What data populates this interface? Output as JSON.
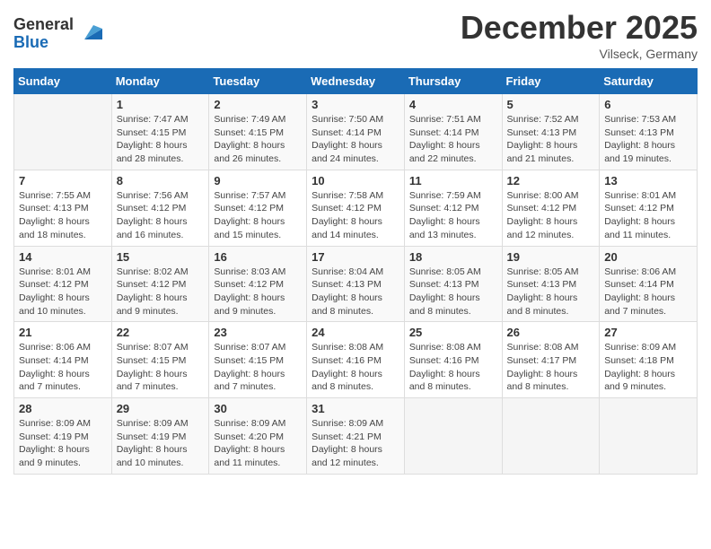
{
  "logo": {
    "general": "General",
    "blue": "Blue"
  },
  "header": {
    "month": "December 2025",
    "location": "Vilseck, Germany"
  },
  "weekdays": [
    "Sunday",
    "Monday",
    "Tuesday",
    "Wednesday",
    "Thursday",
    "Friday",
    "Saturday"
  ],
  "weeks": [
    [
      {
        "day": "",
        "sunrise": "",
        "sunset": "",
        "daylight": ""
      },
      {
        "day": "1",
        "sunrise": "Sunrise: 7:47 AM",
        "sunset": "Sunset: 4:15 PM",
        "daylight": "Daylight: 8 hours and 28 minutes."
      },
      {
        "day": "2",
        "sunrise": "Sunrise: 7:49 AM",
        "sunset": "Sunset: 4:15 PM",
        "daylight": "Daylight: 8 hours and 26 minutes."
      },
      {
        "day": "3",
        "sunrise": "Sunrise: 7:50 AM",
        "sunset": "Sunset: 4:14 PM",
        "daylight": "Daylight: 8 hours and 24 minutes."
      },
      {
        "day": "4",
        "sunrise": "Sunrise: 7:51 AM",
        "sunset": "Sunset: 4:14 PM",
        "daylight": "Daylight: 8 hours and 22 minutes."
      },
      {
        "day": "5",
        "sunrise": "Sunrise: 7:52 AM",
        "sunset": "Sunset: 4:13 PM",
        "daylight": "Daylight: 8 hours and 21 minutes."
      },
      {
        "day": "6",
        "sunrise": "Sunrise: 7:53 AM",
        "sunset": "Sunset: 4:13 PM",
        "daylight": "Daylight: 8 hours and 19 minutes."
      }
    ],
    [
      {
        "day": "7",
        "sunrise": "Sunrise: 7:55 AM",
        "sunset": "Sunset: 4:13 PM",
        "daylight": "Daylight: 8 hours and 18 minutes."
      },
      {
        "day": "8",
        "sunrise": "Sunrise: 7:56 AM",
        "sunset": "Sunset: 4:12 PM",
        "daylight": "Daylight: 8 hours and 16 minutes."
      },
      {
        "day": "9",
        "sunrise": "Sunrise: 7:57 AM",
        "sunset": "Sunset: 4:12 PM",
        "daylight": "Daylight: 8 hours and 15 minutes."
      },
      {
        "day": "10",
        "sunrise": "Sunrise: 7:58 AM",
        "sunset": "Sunset: 4:12 PM",
        "daylight": "Daylight: 8 hours and 14 minutes."
      },
      {
        "day": "11",
        "sunrise": "Sunrise: 7:59 AM",
        "sunset": "Sunset: 4:12 PM",
        "daylight": "Daylight: 8 hours and 13 minutes."
      },
      {
        "day": "12",
        "sunrise": "Sunrise: 8:00 AM",
        "sunset": "Sunset: 4:12 PM",
        "daylight": "Daylight: 8 hours and 12 minutes."
      },
      {
        "day": "13",
        "sunrise": "Sunrise: 8:01 AM",
        "sunset": "Sunset: 4:12 PM",
        "daylight": "Daylight: 8 hours and 11 minutes."
      }
    ],
    [
      {
        "day": "14",
        "sunrise": "Sunrise: 8:01 AM",
        "sunset": "Sunset: 4:12 PM",
        "daylight": "Daylight: 8 hours and 10 minutes."
      },
      {
        "day": "15",
        "sunrise": "Sunrise: 8:02 AM",
        "sunset": "Sunset: 4:12 PM",
        "daylight": "Daylight: 8 hours and 9 minutes."
      },
      {
        "day": "16",
        "sunrise": "Sunrise: 8:03 AM",
        "sunset": "Sunset: 4:12 PM",
        "daylight": "Daylight: 8 hours and 9 minutes."
      },
      {
        "day": "17",
        "sunrise": "Sunrise: 8:04 AM",
        "sunset": "Sunset: 4:13 PM",
        "daylight": "Daylight: 8 hours and 8 minutes."
      },
      {
        "day": "18",
        "sunrise": "Sunrise: 8:05 AM",
        "sunset": "Sunset: 4:13 PM",
        "daylight": "Daylight: 8 hours and 8 minutes."
      },
      {
        "day": "19",
        "sunrise": "Sunrise: 8:05 AM",
        "sunset": "Sunset: 4:13 PM",
        "daylight": "Daylight: 8 hours and 8 minutes."
      },
      {
        "day": "20",
        "sunrise": "Sunrise: 8:06 AM",
        "sunset": "Sunset: 4:14 PM",
        "daylight": "Daylight: 8 hours and 7 minutes."
      }
    ],
    [
      {
        "day": "21",
        "sunrise": "Sunrise: 8:06 AM",
        "sunset": "Sunset: 4:14 PM",
        "daylight": "Daylight: 8 hours and 7 minutes."
      },
      {
        "day": "22",
        "sunrise": "Sunrise: 8:07 AM",
        "sunset": "Sunset: 4:15 PM",
        "daylight": "Daylight: 8 hours and 7 minutes."
      },
      {
        "day": "23",
        "sunrise": "Sunrise: 8:07 AM",
        "sunset": "Sunset: 4:15 PM",
        "daylight": "Daylight: 8 hours and 7 minutes."
      },
      {
        "day": "24",
        "sunrise": "Sunrise: 8:08 AM",
        "sunset": "Sunset: 4:16 PM",
        "daylight": "Daylight: 8 hours and 8 minutes."
      },
      {
        "day": "25",
        "sunrise": "Sunrise: 8:08 AM",
        "sunset": "Sunset: 4:16 PM",
        "daylight": "Daylight: 8 hours and 8 minutes."
      },
      {
        "day": "26",
        "sunrise": "Sunrise: 8:08 AM",
        "sunset": "Sunset: 4:17 PM",
        "daylight": "Daylight: 8 hours and 8 minutes."
      },
      {
        "day": "27",
        "sunrise": "Sunrise: 8:09 AM",
        "sunset": "Sunset: 4:18 PM",
        "daylight": "Daylight: 8 hours and 9 minutes."
      }
    ],
    [
      {
        "day": "28",
        "sunrise": "Sunrise: 8:09 AM",
        "sunset": "Sunset: 4:19 PM",
        "daylight": "Daylight: 8 hours and 9 minutes."
      },
      {
        "day": "29",
        "sunrise": "Sunrise: 8:09 AM",
        "sunset": "Sunset: 4:19 PM",
        "daylight": "Daylight: 8 hours and 10 minutes."
      },
      {
        "day": "30",
        "sunrise": "Sunrise: 8:09 AM",
        "sunset": "Sunset: 4:20 PM",
        "daylight": "Daylight: 8 hours and 11 minutes."
      },
      {
        "day": "31",
        "sunrise": "Sunrise: 8:09 AM",
        "sunset": "Sunset: 4:21 PM",
        "daylight": "Daylight: 8 hours and 12 minutes."
      },
      {
        "day": "",
        "sunrise": "",
        "sunset": "",
        "daylight": ""
      },
      {
        "day": "",
        "sunrise": "",
        "sunset": "",
        "daylight": ""
      },
      {
        "day": "",
        "sunrise": "",
        "sunset": "",
        "daylight": ""
      }
    ]
  ]
}
